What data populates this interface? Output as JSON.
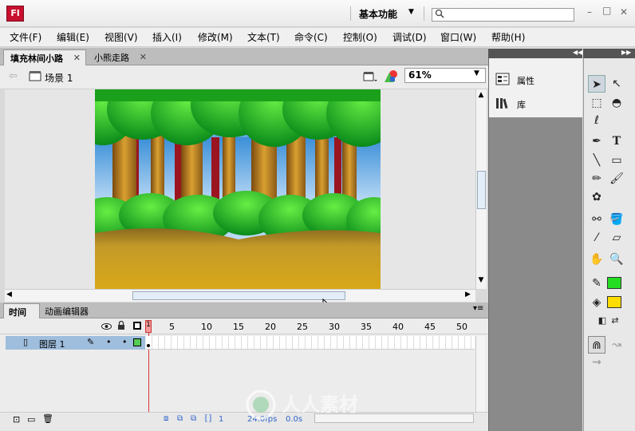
{
  "app": {
    "logo_text": "Fl",
    "workspace": "基本功能",
    "search_placeholder": ""
  },
  "window_controls": {
    "minimize": "–",
    "maximize": "□",
    "close": "✕"
  },
  "menu": [
    "文件(F)",
    "编辑(E)",
    "视图(V)",
    "插入(I)",
    "修改(M)",
    "文本(T)",
    "命令(C)",
    "控制(O)",
    "调试(D)",
    "窗口(W)",
    "帮助(H)"
  ],
  "doc_tabs": [
    {
      "label": "填充林间小路",
      "active": true
    },
    {
      "label": "小熊走路",
      "active": false
    }
  ],
  "scene": {
    "back_arrow": "⇦",
    "label": "场景 1",
    "zoom": "61%"
  },
  "timeline": {
    "tabs": [
      "时间轴",
      "动画编辑器"
    ],
    "frame_numbers": [
      "1",
      "5",
      "10",
      "15",
      "20",
      "25",
      "30",
      "35",
      "40",
      "45",
      "50"
    ],
    "layer_name": "图层 1",
    "current_frame": "1",
    "fps": "24.0fps",
    "time": "0.0s"
  },
  "panels": {
    "properties": "属性",
    "library": "库"
  },
  "tools": {
    "stroke_color": "#22dd22",
    "fill_color": "#ffdd00"
  },
  "colors": {
    "accent": "#c8102e",
    "selection": "#9fbddc"
  }
}
